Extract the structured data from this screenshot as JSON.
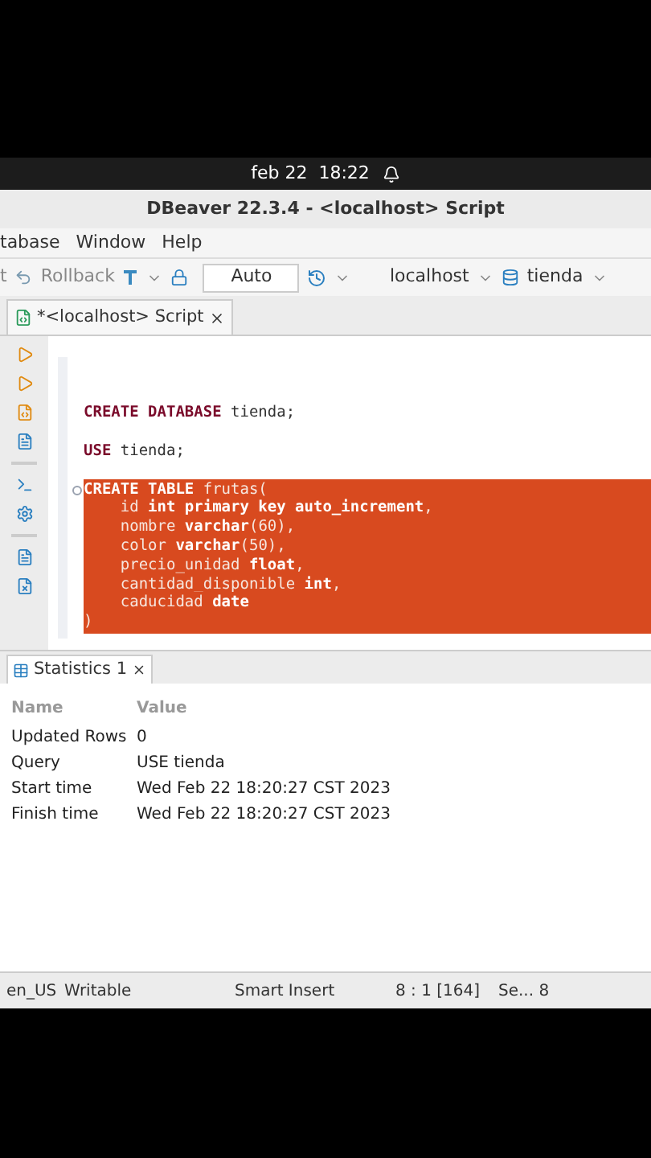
{
  "top_bar": {
    "clock": "feb 22  18:22"
  },
  "window": {
    "title": "DBeaver 22.3.4 - <localhost> Script"
  },
  "menu": [
    "tabase",
    "Window",
    "Help"
  ],
  "toolbar": {
    "cut_label": "t",
    "rollback": "Rollback",
    "mode": "Auto",
    "connection": "localhost",
    "schema": "tienda"
  },
  "editor_tab": {
    "label": "*<localhost> Script",
    "selected": true
  },
  "code": [
    {
      "kind": "blank"
    },
    {
      "kind": "blank"
    },
    {
      "segments": [
        {
          "text": "CREATE DATABASE",
          "kind": "keyword"
        },
        {
          "text": " tienda;",
          "kind": "plain"
        }
      ],
      "selected": false
    },
    {
      "kind": "blank"
    },
    {
      "segments": [
        {
          "text": "USE",
          "kind": "keyword"
        },
        {
          "text": " tienda;",
          "kind": "plain"
        }
      ],
      "selected": false
    },
    {
      "kind": "blank"
    },
    {
      "segments": [
        {
          "text": "CREATE TABLE",
          "kind": "keyword"
        },
        {
          "text": " frutas(",
          "kind": "plain"
        }
      ],
      "selected": true,
      "fold": true
    },
    {
      "segments": [
        {
          "text": "    id ",
          "kind": "plain"
        },
        {
          "text": "int primary key auto_increment",
          "kind": "keyword"
        },
        {
          "text": ",",
          "kind": "plain"
        }
      ],
      "selected": true
    },
    {
      "segments": [
        {
          "text": "    nombre ",
          "kind": "plain"
        },
        {
          "text": "varchar",
          "kind": "keyword"
        },
        {
          "text": "(60),",
          "kind": "plain"
        }
      ],
      "selected": true
    },
    {
      "segments": [
        {
          "text": "    color ",
          "kind": "plain"
        },
        {
          "text": "varchar",
          "kind": "keyword"
        },
        {
          "text": "(50),",
          "kind": "plain"
        }
      ],
      "selected": true
    },
    {
      "segments": [
        {
          "text": "    precio_unidad ",
          "kind": "plain"
        },
        {
          "text": "float",
          "kind": "keyword"
        },
        {
          "text": ",",
          "kind": "plain"
        }
      ],
      "selected": true
    },
    {
      "segments": [
        {
          "text": "    cantidad_disponible ",
          "kind": "plain"
        },
        {
          "text": "int",
          "kind": "keyword"
        },
        {
          "text": ",",
          "kind": "plain"
        }
      ],
      "selected": true
    },
    {
      "segments": [
        {
          "text": "    caducidad ",
          "kind": "plain"
        },
        {
          "text": "date",
          "kind": "keyword"
        }
      ],
      "selected": true
    },
    {
      "segments": [
        {
          "text": ")",
          "kind": "plain"
        }
      ],
      "selected": true
    }
  ],
  "results_tab": {
    "label": "Statistics 1",
    "selected": true
  },
  "stats": {
    "columns": [
      "Name",
      "Value"
    ],
    "rows": [
      [
        "Updated Rows",
        "0"
      ],
      [
        "Query",
        "USE tienda"
      ],
      [
        "Start time",
        "Wed Feb 22 18:20:27 CST 2023"
      ],
      [
        "Finish time",
        "Wed Feb 22 18:20:27 CST 2023"
      ]
    ]
  },
  "status_bar": [
    "en_US",
    "Writable",
    "Smart Insert",
    "8 : 1 [164]",
    "Se... 8"
  ]
}
